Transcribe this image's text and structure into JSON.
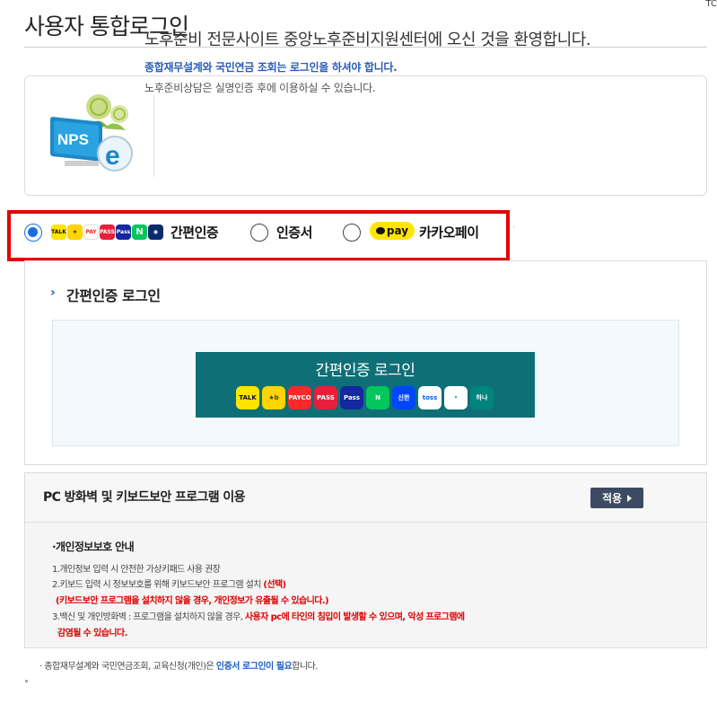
{
  "page_title": "사용자 통합로그인",
  "top_corner": "TC",
  "welcome": {
    "logo_text": "NPS",
    "main": "노후준비 전문사이트 중앙노후준비지원센터에 오신 것을 환영합니다.",
    "note": "종합재무설계와 국민연금 조회는 로그인을 하셔야 합니다.",
    "sub": "노후준비상담은 실명인증 후에 이용하실 수 있습니다."
  },
  "login_methods": [
    {
      "label": "간편인증",
      "selected": true
    },
    {
      "label": "인증서",
      "selected": false
    },
    {
      "label": "카카오페이",
      "selected": false,
      "badge": "pay"
    }
  ],
  "method_icons": [
    "talk-icon",
    "kb-icon",
    "payco-icon",
    "pass-icon",
    "samsung-pass-icon",
    "naver-icon",
    "shinhan-icon"
  ],
  "login_panel": {
    "heading": "간편인증 로그인",
    "button_label": "간편인증 로그인",
    "providers": [
      {
        "name": "kakao-talk",
        "text": "TALK",
        "bg": "#fee500",
        "fg": "#111111"
      },
      {
        "name": "kb",
        "text": "★b",
        "bg": "#ffd400",
        "fg": "#3a3a3a"
      },
      {
        "name": "payco",
        "text": "PAYCO",
        "bg": "#fa2828",
        "fg": "#ffffff"
      },
      {
        "name": "pass",
        "text": "PASS",
        "bg": "#e6203a",
        "fg": "#ffffff"
      },
      {
        "name": "samsung-pass",
        "text": "Pass",
        "bg": "#1428a0",
        "fg": "#ffffff"
      },
      {
        "name": "naver",
        "text": "N",
        "bg": "#03c75a",
        "fg": "#ffffff"
      },
      {
        "name": "shinhan",
        "text": "신한",
        "bg": "#0046ff",
        "fg": "#ffffff"
      },
      {
        "name": "toss",
        "text": "toss",
        "bg": "#ffffff",
        "fg": "#0064ff"
      },
      {
        "name": "bank-salad",
        "text": "•",
        "bg": "#ffffff",
        "fg": "#2fb67a"
      },
      {
        "name": "hana",
        "text": "하나",
        "bg": "#00857c",
        "fg": "#ffffff"
      }
    ]
  },
  "security": {
    "title": "PC 방화벽 및 키보드보안 프로그램 이용",
    "apply_label": "적용",
    "notice_title": "·개인정보보호 안내",
    "line1": "1.개인정보 입력 시 안전한 가상키패드 사용 권장",
    "line2_a": "2.키보드 입력 시 정보보호를 위해 키보드보안 프로그램 설치 ",
    "line2_b": "(선택)",
    "line3": "(키보드보안 프로그램을 설치하지 않을 경우, 개인정보가 유출될 수 있습니다.)",
    "line4_a": "3.백신 및 개인방화벽 : 프로그램을 설치하지 않을 경우, ",
    "line4_b": "사용자 pc에 타인의 침입이 발생할 수 있으며, 악성 프로그램에",
    "line5": "감염될 수 있습니다."
  },
  "footer": {
    "text_a": "· 종합재무설계와 국민연금조회, 교육신청(개인)은 ",
    "text_b": "인증서 로그인이 필요",
    "text_c": "합니다."
  },
  "colors": {
    "highlight_border": "#e30000",
    "login_button": "#0f6f77",
    "radio_selected": "#1a6fe0",
    "apply_button": "#3d4a63"
  }
}
